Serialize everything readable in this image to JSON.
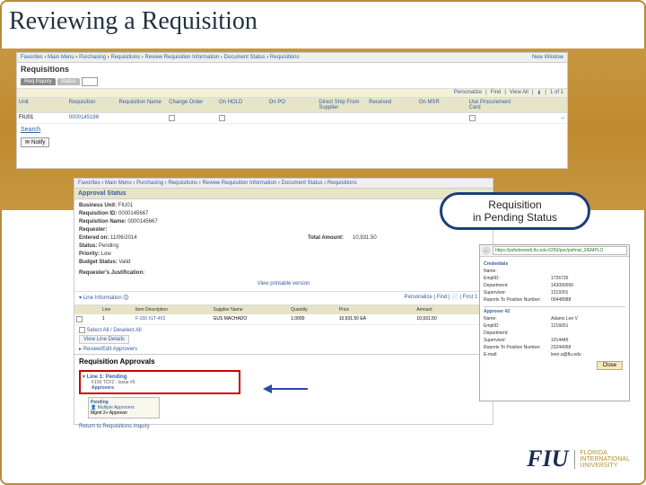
{
  "title": "Reviewing a Requisition",
  "callout": "Requisition\nin Pending Status",
  "top": {
    "crumbs": [
      "Favorites",
      "Main Menu",
      "Purchasing",
      "Requisitions",
      "Review Requisition Information",
      "Document Status",
      "Requisitions"
    ],
    "new_window": "New Window",
    "header": "Requisitions",
    "tabs": {
      "active": "Req Inquiry",
      "inactive": "Status"
    },
    "toolbar": {
      "personalize": "Personalize",
      "find": "Find",
      "view_all": "View All",
      "range": "1 of 1"
    },
    "cols": [
      "Unit",
      "Requisition",
      "Requisition Name",
      "Change Order",
      "On HOLD",
      "On PO",
      "Direct Ship From Supplier",
      "Received",
      "On MSR",
      "Use Procurement Card",
      ""
    ],
    "row": {
      "unit": "FIU01",
      "req": "0000145198",
      "name": "",
      "change": "",
      "onhold": "",
      "onpo": "",
      "ds": "",
      "recv": "",
      "onmsr": "",
      "upc": "",
      "arrow": "→"
    },
    "search": "Search",
    "notify": "Notify"
  },
  "mid": {
    "crumbs": [
      "Favorites",
      "Main Menu",
      "Purchasing",
      "Requisitions",
      "Review Requisition Information",
      "Document Status",
      "Requisitions"
    ],
    "approval": "Approval Status",
    "kv": {
      "bu": {
        "k": "Business Unit:",
        "v": "FIU01"
      },
      "reqid": {
        "k": "Requisition ID:",
        "v": "0000145667"
      },
      "reqname": {
        "k": "Requisition Name:",
        "v": "0000145667"
      },
      "requester": {
        "k": "Requester:",
        "v": ""
      },
      "entered": {
        "k": "Entered on:",
        "v": "11/06/2014"
      },
      "status": {
        "k": "Status:",
        "v": "Pending"
      },
      "priority": {
        "k": "Priority:",
        "v": "Low"
      },
      "budget": {
        "k": "Budget Status:",
        "v": "Valid"
      },
      "total_k": "Total Amount:",
      "total_v": "10,931.50"
    },
    "just": "Requester's Justification:",
    "viewprint": "View printable version",
    "lineinfo": "Line Information",
    "linebar": {
      "personalize": "Personalize",
      "find": "Find",
      "first": "First",
      "range": "1 of 1"
    },
    "linecols": [
      "Line",
      "Item Description",
      "Supplier Name",
      "Quantity",
      "Price",
      "Amount"
    ],
    "linerow": {
      "line": "1",
      "desc": "F-150 XLT-4X2",
      "supp": "GUS MACHADO",
      "qty": "1.0000",
      "price": "10,931.50 EA",
      "amt": "10,931.50"
    },
    "selectall": "Select All / Deselect All",
    "viewline": "View Line Details",
    "reviewedit": "Review/Edit Approvers",
    "reqapprovals": "Requisition Approvals",
    "linepending": "Line 1: Pending",
    "linependingsub": "F150 TCF2 - Issue #5",
    "approvers": "Approvers",
    "pendbox": {
      "p": "Pending",
      "who": "Multiple Approvers",
      "txt": "Mgmt 2+ Approver"
    },
    "return": "Return to Requisitions Inquiry"
  },
  "popup": {
    "url": "https://psfsdevweb.fiu.edu:6250/psc/psfmat_3/EMPLO",
    "cred": "Credentials",
    "kv": {
      "name": {
        "k": "Name:",
        "v": ""
      },
      "emplid": {
        "k": "EmplID:",
        "v": "1726735"
      },
      "dept": {
        "k": "Department:",
        "v": "143000000"
      },
      "super": {
        "k": "Supervisor:",
        "v": "1219301"
      },
      "repk": "Reports To Position Number:",
      "repv": "00448988"
    },
    "app2": "Approver #2",
    "kv2": {
      "name": {
        "k": "Name:",
        "v": "Adams Len V"
      },
      "emplid": {
        "k": "EmplID:",
        "v": "1216651"
      },
      "dept": {
        "k": "Department:",
        "v": ""
      },
      "super": {
        "k": "Supervisor:",
        "v": "1014445"
      },
      "repk": "Reports To Position Number:",
      "repv": "23244068",
      "email": {
        "k": "E-mail:",
        "v": "leen.a@fiu.edu"
      }
    },
    "close": "Close"
  },
  "fiu": {
    "mark": "FIU",
    "line1": "FLORIDA",
    "line2": "INTERNATIONAL",
    "line3": "UNIVERSITY"
  }
}
